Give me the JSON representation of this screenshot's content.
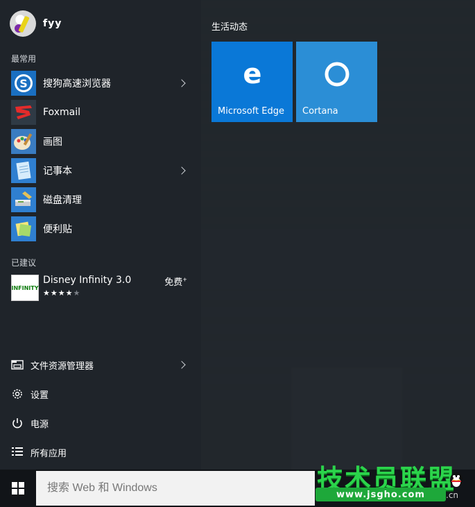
{
  "user": {
    "name": "fyy"
  },
  "sections": {
    "most_used": "最常用",
    "suggested": "已建议",
    "live_tiles": "生活动态"
  },
  "most_used": [
    {
      "label": "搜狗高速浏览器",
      "icon": "sogou-browser-icon",
      "has_submenu": true
    },
    {
      "label": "Foxmail",
      "icon": "foxmail-icon",
      "has_submenu": false
    },
    {
      "label": "画图",
      "icon": "paint-icon",
      "has_submenu": false
    },
    {
      "label": "记事本",
      "icon": "notepad-icon",
      "has_submenu": true
    },
    {
      "label": "磁盘清理",
      "icon": "disk-cleanup-icon",
      "has_submenu": false
    },
    {
      "label": "便利贴",
      "icon": "sticky-notes-icon",
      "has_submenu": false
    }
  ],
  "suggested_app": {
    "name": "Disney Infinity 3.0",
    "price": "免费",
    "price_mark": "+",
    "rating_filled": "★★★★",
    "rating_empty": "★",
    "icon_text": "INFINITY"
  },
  "bottom_items": [
    {
      "label": "文件资源管理器",
      "icon": "file-explorer-icon",
      "has_submenu": true
    },
    {
      "label": "设置",
      "icon": "gear-icon",
      "has_submenu": false
    },
    {
      "label": "电源",
      "icon": "power-icon",
      "has_submenu": false
    },
    {
      "label": "所有应用",
      "icon": "all-apps-icon",
      "has_submenu": false
    }
  ],
  "tiles": [
    {
      "label": "Microsoft Edge",
      "icon": "edge-icon",
      "color": "#0a78d7"
    },
    {
      "label": "Cortana",
      "icon": "cortana-icon",
      "color": "#2b8ed6"
    }
  ],
  "taskbar": {
    "search_placeholder": "搜索 Web 和 Windows"
  },
  "watermark": {
    "text": "技术员联盟",
    "url": "www.jsgho.com",
    "suffix": ".cn"
  },
  "colors": {
    "start_left_bg": "#1f242a",
    "tile_blue": "#0a78d7",
    "watermark_green": "#2bd44b"
  }
}
